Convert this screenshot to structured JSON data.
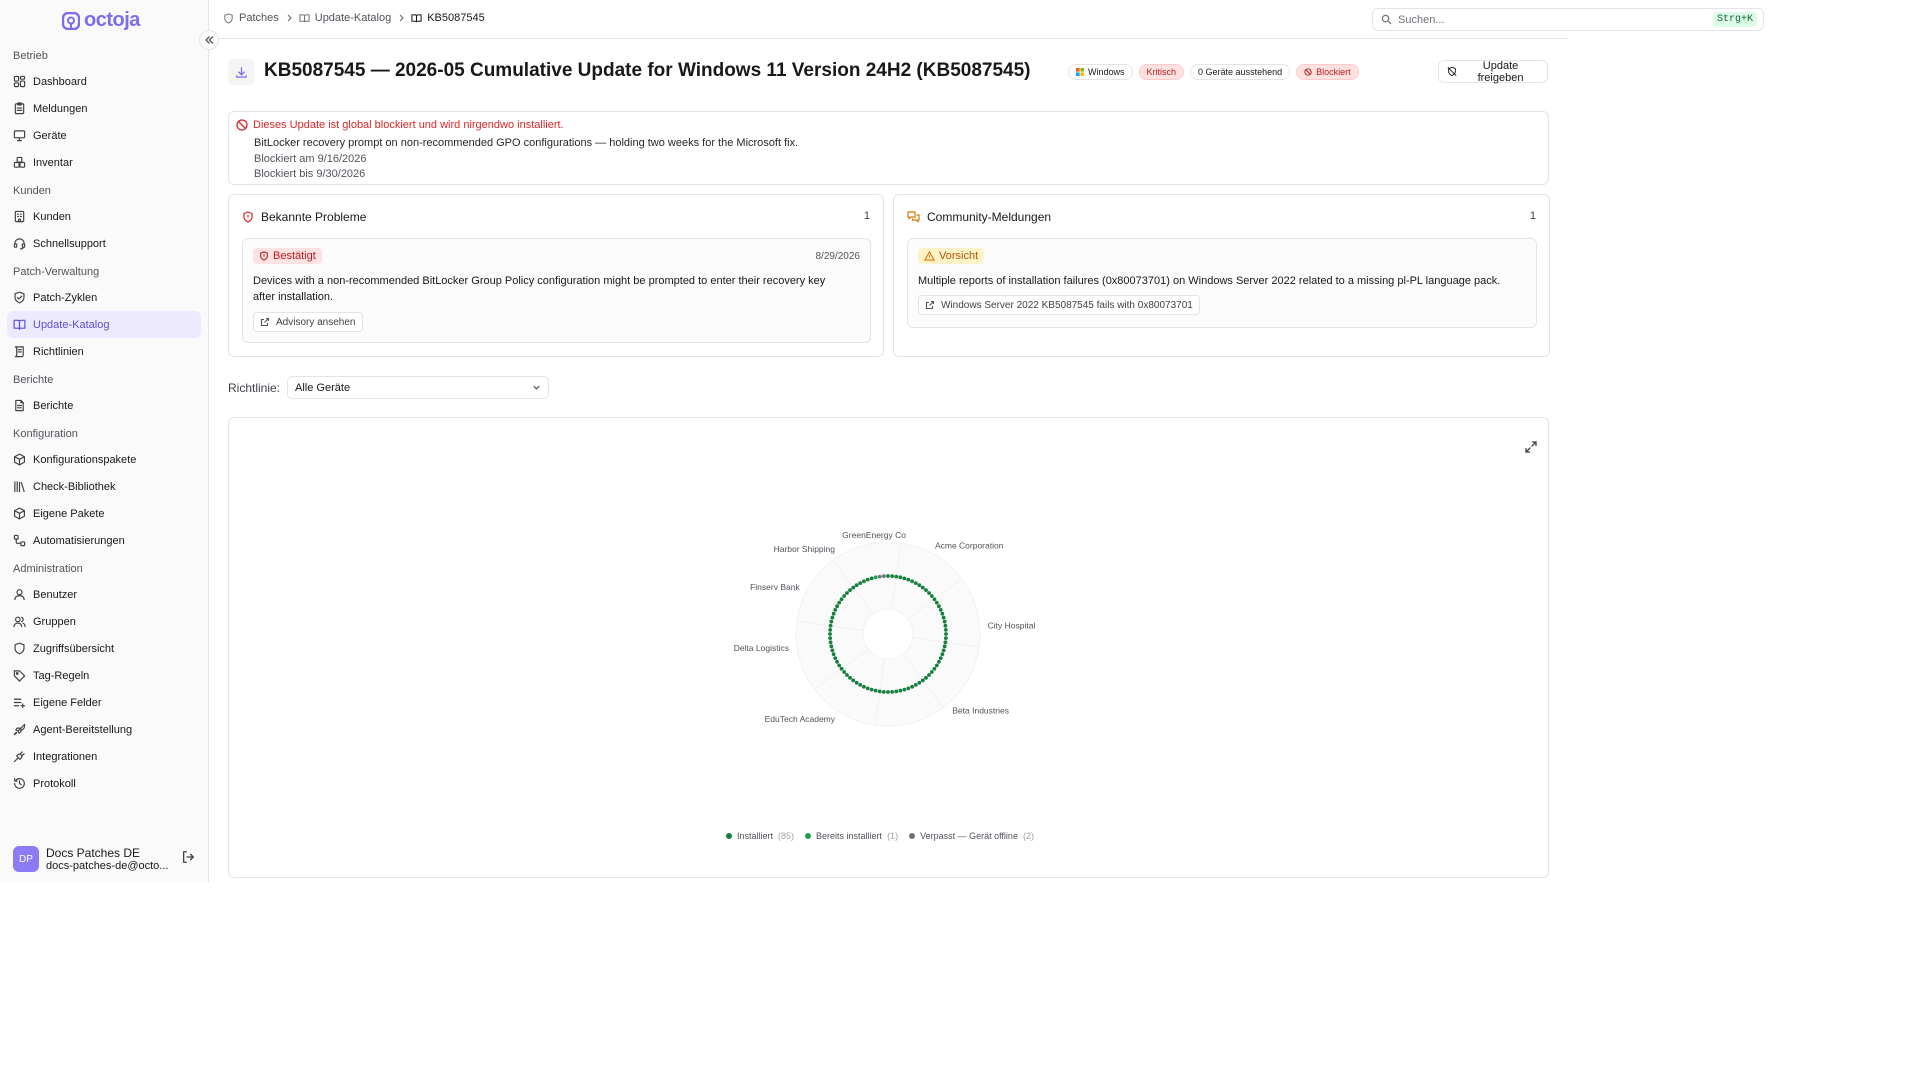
{
  "app": {
    "brand": "octoja"
  },
  "sidebar": {
    "sections": [
      {
        "title": "Betrieb",
        "items": [
          {
            "label": "Dashboard",
            "icon": "dashboard-icon"
          },
          {
            "label": "Meldungen",
            "icon": "clipboard-icon"
          },
          {
            "label": "Geräte",
            "icon": "monitor-icon"
          },
          {
            "label": "Inventar",
            "icon": "boxes-icon"
          }
        ]
      },
      {
        "title": "Kunden",
        "items": [
          {
            "label": "Kunden",
            "icon": "building-icon"
          },
          {
            "label": "Schnellsupport",
            "icon": "headset-icon"
          }
        ]
      },
      {
        "title": "Patch-Verwaltung",
        "items": [
          {
            "label": "Patch-Zyklen",
            "icon": "shield-check-icon"
          },
          {
            "label": "Update-Katalog",
            "icon": "book-open-icon",
            "active": true
          },
          {
            "label": "Richtlinien",
            "icon": "scroll-icon"
          }
        ]
      },
      {
        "title": "Berichte",
        "items": [
          {
            "label": "Berichte",
            "icon": "file-text-icon"
          }
        ]
      },
      {
        "title": "Konfiguration",
        "items": [
          {
            "label": "Konfigurationspakete",
            "icon": "package-icon"
          },
          {
            "label": "Check-Bibliothek",
            "icon": "library-icon"
          },
          {
            "label": "Eigene Pakete",
            "icon": "package-icon"
          },
          {
            "label": "Automatisierungen",
            "icon": "workflow-icon"
          }
        ]
      },
      {
        "title": "Administration",
        "items": [
          {
            "label": "Benutzer",
            "icon": "user-icon"
          },
          {
            "label": "Gruppen",
            "icon": "users-icon"
          },
          {
            "label": "Zugriffsübersicht",
            "icon": "shield-icon"
          },
          {
            "label": "Tag-Regeln",
            "icon": "tag-icon"
          },
          {
            "label": "Eigene Felder",
            "icon": "list-plus-icon"
          },
          {
            "label": "Agent-Bereitstellung",
            "icon": "rocket-icon"
          },
          {
            "label": "Integrationen",
            "icon": "plug-icon"
          },
          {
            "label": "Protokoll",
            "icon": "history-icon"
          }
        ]
      }
    ],
    "user": {
      "initials": "DP",
      "name": "Docs Patches DE",
      "email": "docs-patches-de@octo..."
    }
  },
  "topbar": {
    "breadcrumb": [
      "Patches",
      "Update-Katalog",
      "KB5087545"
    ],
    "search": {
      "placeholder": "Suchen...",
      "shortcut": "Strg+K"
    }
  },
  "header": {
    "title": "KB5087545 — 2026-05 Cumulative Update for Windows 11 Version 24H2 (KB5087545)",
    "badges": {
      "os": "Windows",
      "severity": "Kritisch",
      "pending": "0 Geräte ausstehend",
      "status": "Blockiert"
    },
    "release_button": "Update freigeben"
  },
  "alert": {
    "title": "Dieses Update ist global blockiert und wird nirgendwo installiert.",
    "reason": "BitLocker recovery prompt on non-recommended GPO configurations — holding two weeks for the Microsoft fix.",
    "blocked_on": "Blockiert am 9/16/2026",
    "blocked_until": "Blockiert bis 9/30/2026"
  },
  "known_issues": {
    "title": "Bekannte Probleme",
    "count": "1",
    "item": {
      "status": "Bestätigt",
      "date": "8/29/2026",
      "text": "Devices with a non-recommended BitLocker Group Policy configuration might be prompted to enter their recovery key after installation.",
      "link": "Advisory ansehen"
    }
  },
  "community": {
    "title": "Community-Meldungen",
    "count": "1",
    "item": {
      "status": "Vorsicht",
      "text": "Multiple reports of installation failures (0x80073701) on Windows Server 2022 related to a missing pl-PL language pack.",
      "link": "Windows Server 2022 KB5087545 fails with 0x80073701"
    }
  },
  "policy": {
    "label": "Richtlinie:",
    "value": "Alle Geräte"
  },
  "colors": {
    "installed": "#15803d",
    "already_installed": "#16a34a",
    "missed": "#71717a",
    "accent": "#7c6cf0",
    "danger": "#dc2626"
  },
  "chart_data": {
    "type": "radial-dot",
    "categories": [
      "Acme Corporation",
      "City Hospital",
      "Beta Industries",
      "EduTech Academy",
      "Delta Logistics",
      "Finserv Bank",
      "Harbor Shipping",
      "GreenEnergy Co"
    ],
    "legend": [
      {
        "name": "Installiert",
        "count": "(85)",
        "value": 85,
        "color": "#15803d"
      },
      {
        "name": "Bereits installiert",
        "count": "(1)",
        "value": 1,
        "color": "#16a34a"
      },
      {
        "name": "Verpasst — Gerät offline",
        "count": "(2)",
        "value": 2,
        "color": "#71717a"
      }
    ]
  }
}
